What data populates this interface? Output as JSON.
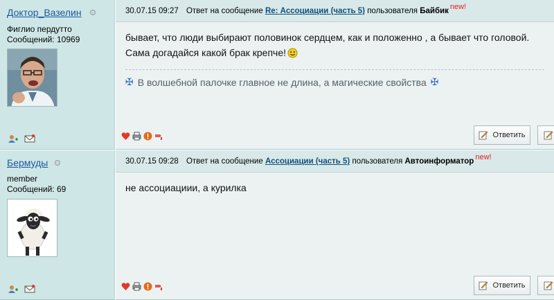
{
  "posts": [
    {
      "username": "Доктор_Вазелин",
      "user_title": "Фиглио пердутто",
      "messages": "Сообщений: 10969",
      "date": "30.07.15 09:27",
      "reply_prefix": "Ответ на сообщение",
      "reply_topic": "Re: Ассоциации (часть 5)",
      "by_label": "пользователя",
      "reply_author": "Байбик",
      "new_badge": "new!",
      "body_lines": [
        "бывает, что люди выбирают половинок сердцем, как и положенно , а бывает что головой.",
        "Сама догадайся какой брак крепче!"
      ],
      "signature": "В волшебной палочке главное не длина, а магические свойства",
      "reply_button": "Ответить"
    },
    {
      "username": "Бермуды",
      "user_title": "member",
      "messages": "Сообщений: 69",
      "date": "30.07.15 09:28",
      "reply_prefix": "Ответ на сообщение",
      "reply_topic": "Ассоциации (часть 5)",
      "by_label": "пользователя",
      "reply_author": "Автоинформатор",
      "new_badge": "new!",
      "body_lines": [
        "не ассоциациии, а курилка"
      ],
      "reply_button": "Ответить"
    }
  ],
  "colors": {
    "sidebar_bg": "#cfe6e6",
    "content_bg": "#ecf2f2",
    "link": "#1a5aa0",
    "new_badge": "#e02020"
  },
  "icons": {
    "user_icons": [
      "add-contact-icon",
      "message-icon"
    ],
    "post_icons": [
      "like-heart-icon",
      "print-icon",
      "report-icon",
      "moderator-icon"
    ],
    "reply_button_icon": "compose-icon",
    "signature_icon": "cross-ornament-icon"
  }
}
